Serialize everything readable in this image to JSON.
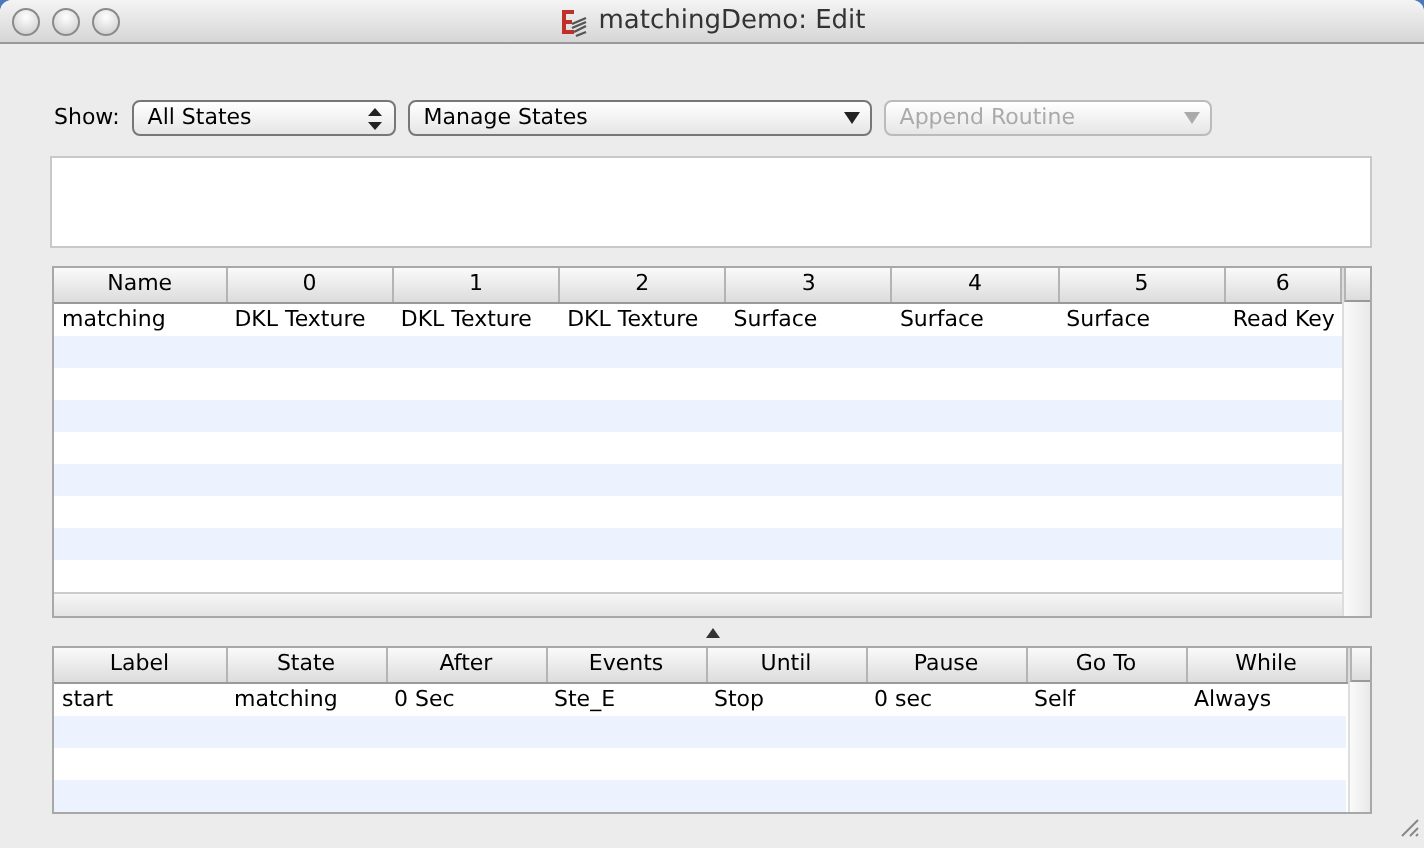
{
  "window": {
    "title": "matchingDemo: Edit"
  },
  "toolbar": {
    "show_label": "Show:",
    "controls": [
      {
        "kind": "stepper",
        "value": "All States",
        "disabled": false
      },
      {
        "kind": "dropdown",
        "value": "Manage States",
        "disabled": false
      },
      {
        "kind": "dropdown",
        "value": "Append Routine",
        "disabled": true
      }
    ]
  },
  "states_table": {
    "columns": [
      "Name",
      "0",
      "1",
      "2",
      "3",
      "4",
      "5",
      "6"
    ],
    "rows": [
      [
        "matching",
        "DKL Texture",
        "DKL Texture",
        "DKL Texture",
        "Surface",
        "Surface",
        "Surface",
        "Read Key"
      ]
    ]
  },
  "transitions_table": {
    "columns": [
      "Label",
      "State",
      "After",
      "Events",
      "Until",
      "Pause",
      "Go To",
      "While"
    ],
    "rows": [
      [
        "start",
        "matching",
        "0 Sec",
        "Ste_E",
        "Stop",
        "0 sec",
        "Self",
        "Always"
      ]
    ]
  }
}
